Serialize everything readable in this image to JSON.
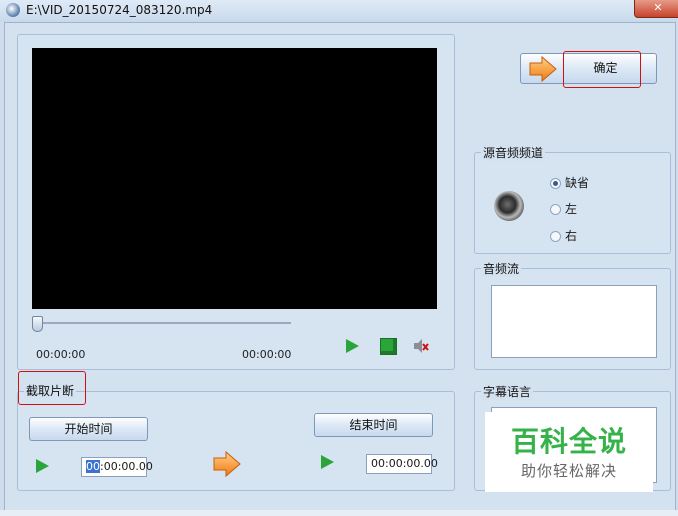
{
  "window": {
    "title": "E:\\VID_20150724_083120.mp4",
    "close_label": "✕"
  },
  "player": {
    "position_time": "00:00:00",
    "duration_time": "00:00:00",
    "slider_fraction": 0.0
  },
  "confirm": {
    "label": "确定"
  },
  "clip": {
    "legend": "截取片断",
    "start_button": "开始时间",
    "end_button": "结束时间",
    "start_time_selected": "00",
    "start_time_rest": ":00:00.00",
    "end_time": "00:00:00.00"
  },
  "audio_channel": {
    "legend": "源音频频道",
    "options": [
      "缺省",
      "左",
      "右"
    ],
    "selected_index": 0
  },
  "audio_stream": {
    "legend": "音频流"
  },
  "subtitle": {
    "legend": "字幕语言"
  },
  "watermark": {
    "title": "百科全说",
    "subtitle": "助你轻松解决"
  },
  "colors": {
    "accent_red": "#d11010",
    "play_green": "#2aa53a",
    "watermark_green": "#36b24a"
  },
  "icons": [
    "app-icon",
    "close-icon",
    "play-icon",
    "stop-icon",
    "mute-icon",
    "arrow-right-icon",
    "speaker-icon"
  ]
}
